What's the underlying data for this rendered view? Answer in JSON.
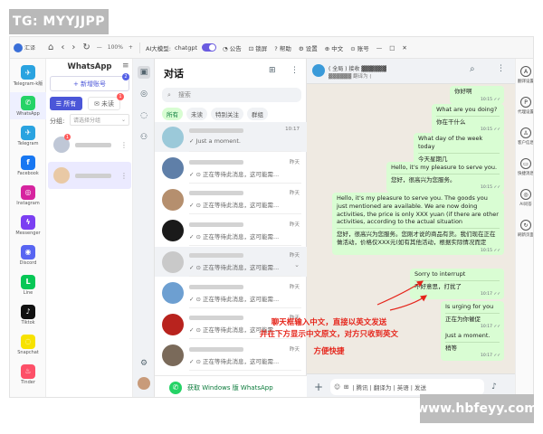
{
  "watermark_top": "TG: MYYJJPP",
  "watermark_bottom": "www.hbfeyy.com",
  "toolbar": {
    "logo_label": "汇译",
    "back": "‹",
    "forward": "›",
    "refresh": "↻",
    "home": "⌂",
    "zoom_minus": "—",
    "zoom_value": "100%",
    "zoom_plus": "+",
    "ai_model_label": "AI大模型:",
    "ai_model_value": "chatgpt",
    "announce": "公告",
    "lock": "锁屏",
    "help": "帮助",
    "settings": "设置",
    "language": "中文",
    "account": "账号"
  },
  "appbar": [
    {
      "label": "Telegram-k版",
      "color": "#2aa3e0",
      "glyph": "✈"
    },
    {
      "label": "WhatsApp",
      "color": "#25d366",
      "glyph": "✆"
    },
    {
      "label": "Telegram",
      "color": "#2aa3e0",
      "glyph": "✈"
    },
    {
      "label": "Facebook",
      "color": "#1877f2",
      "glyph": "f"
    },
    {
      "label": "Instagram",
      "color": "#d6249f",
      "glyph": "◎"
    },
    {
      "label": "Messenger",
      "color": "#7b3ff2",
      "glyph": "ϟ"
    },
    {
      "label": "Discord",
      "color": "#5865f2",
      "glyph": "◉"
    },
    {
      "label": "Line",
      "color": "#06c755",
      "glyph": "L"
    },
    {
      "label": "Tiktok",
      "color": "#111111",
      "glyph": "♪"
    },
    {
      "label": "Snapchat",
      "color": "#f7e200",
      "glyph": "◌"
    },
    {
      "label": "Tinder",
      "color": "#fd5068",
      "glyph": "♨"
    }
  ],
  "accounts": {
    "title": "WhatsApp",
    "add_button": "+ 新增账号",
    "add_badge": "2",
    "tab_all": "所有",
    "tab_unread": "未读",
    "tab_unread_badge": "1",
    "group_label": "分组:",
    "group_placeholder": "请选择分组",
    "first_badge": "1"
  },
  "chatlist": {
    "title": "对话",
    "search_placeholder": "搜索",
    "filters": [
      "所有",
      "未读",
      "特别关注",
      "群组"
    ],
    "items": [
      {
        "time": "10:17",
        "msg": "✓ Just a moment.",
        "avatar": "#9bc9d9"
      },
      {
        "time": "昨天",
        "msg": "✓ ⊙ 正在等待此消息，这可能需...",
        "avatar": "#5f7fa8"
      },
      {
        "time": "昨天",
        "msg": "✓ ⊙ 正在等待此消息，这可能需...",
        "avatar": "#b58f6e"
      },
      {
        "time": "昨天",
        "msg": "✓ ⊙ 正在等待此消息，这可能需...",
        "avatar": "#1a1a1a"
      },
      {
        "time": "昨天",
        "msg": "✓ ⊙ 正在等待此消息，这可能需...",
        "avatar": "#c9c9c9"
      },
      {
        "time": "昨天",
        "msg": "✓ ⊙ 正在等待此消息，这可能需...",
        "avatar": "#6d9fd1"
      },
      {
        "time": "昨天",
        "msg": "✓ ⊙ 正在等待此消息，这可能需...",
        "avatar": "#b8231e"
      },
      {
        "time": "昨天",
        "msg": "✓ ⊙ 正在等待此消息，这可能需...",
        "avatar": "#7a6a5a"
      }
    ],
    "footer": "获取 Windows 版 WhatsApp"
  },
  "conversation": {
    "header_name": "( 全局 ) 接收 ▓▓▓▓▓▓",
    "header_sub": "▓▓▓▓▓▓ 翻译为 (",
    "messages": [
      {
        "text": "",
        "tr": "你好啊",
        "time": "10:15 ✓✓"
      },
      {
        "text": "What are you doing?",
        "tr": "你在干什么",
        "time": "10:15 ✓✓"
      },
      {
        "text": "What day of the week today",
        "tr": "今天星期几",
        "time": "10:15 ✓✓"
      },
      {
        "text": "Hello, it's my pleasure to serve you.",
        "tr": "您好，很高兴为您服务。",
        "time": "10:15 ✓✓"
      },
      {
        "text": "Hello, it's my pleasure to serve you. The goods you just mentioned are available. We are now doing activities, the price is only XXX yuan (if there are other activities, according to the actual situation",
        "tr": "您好，很高兴为您服务。您刚才说的商品有货。我们现在正在做活动，价格仅XXX元(如有其他活动，根据实际情况而定",
        "time": "10:15 ✓✓"
      },
      {
        "text": "Sorry to interrupt",
        "tr": "不好意思，打扰了",
        "time": "10:17 ✓✓"
      },
      {
        "text": "Is urging for you",
        "tr": "正在为你催促",
        "time": "10:17 ✓✓"
      },
      {
        "text": "Just a moment.",
        "tr": "稍等",
        "time": "10:17 ✓✓"
      }
    ],
    "annotation_lines": [
      "聊天框输入中文，直接以英文发送",
      "并在下方显示中文原文，对方只收到英文",
      "方便快捷"
    ],
    "composer_text": "| 腾讯 | 翻译为 | 英语 | 发送"
  },
  "rail": [
    {
      "label": "翻译设置",
      "glyph": "A"
    },
    {
      "label": "代理设置",
      "glyph": "P"
    },
    {
      "label": "客户信息",
      "glyph": "♙"
    },
    {
      "label": "快捷消息",
      "glyph": "▭"
    },
    {
      "label": "AI问答",
      "glyph": "◎"
    },
    {
      "label": "刷新页面",
      "glyph": "↻"
    }
  ]
}
